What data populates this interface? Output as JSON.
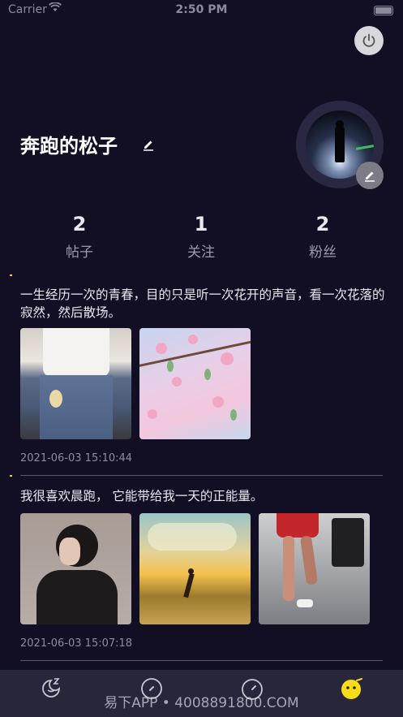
{
  "status_bar": {
    "carrier": "Carrier",
    "wifi_icon": "wifi-icon",
    "time": "2:50 PM",
    "battery_icon": "battery-icon"
  },
  "profile": {
    "username": "奔跑的松子",
    "stats": [
      {
        "value": "2",
        "label": "帖子"
      },
      {
        "value": "1",
        "label": "关注"
      },
      {
        "value": "2",
        "label": "粉丝"
      }
    ]
  },
  "posts": [
    {
      "text": "一生经历一次的青春，目的只是听一次花开的声音，看一次花落的寂然，然后散场。",
      "timestamp": "2021-06-03 15:10:44"
    },
    {
      "text": "我很喜欢晨跑， 它能带给我一天的正能量。",
      "timestamp": "2021-06-03 15:07:18"
    }
  ],
  "tab_bar": {
    "tabs": [
      "moon-sleep-icon",
      "compass-icon",
      "timer-icon",
      "smiley-face-icon"
    ],
    "active_color": "#f7dd16"
  },
  "watermark": "易下APP • 4008891800.COM",
  "colors": {
    "background": "#120f24",
    "tab_bar": "#28263a",
    "accent": "#f7dd16"
  }
}
